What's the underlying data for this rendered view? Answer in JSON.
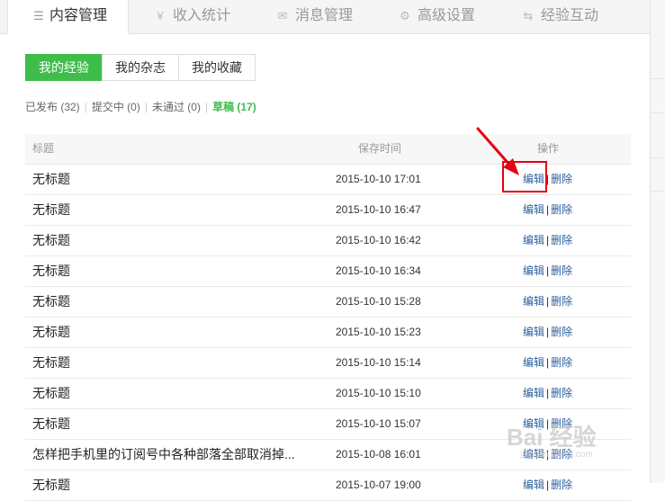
{
  "top_tabs": [
    {
      "label": "内容管理",
      "icon": "list-icon",
      "glyph": "☰",
      "active": true
    },
    {
      "label": "收入统计",
      "icon": "yen-icon",
      "glyph": "¥",
      "active": false
    },
    {
      "label": "消息管理",
      "icon": "envelope-icon",
      "glyph": "✉",
      "active": false
    },
    {
      "label": "高级设置",
      "icon": "gear-icon",
      "glyph": "⚙",
      "active": false
    },
    {
      "label": "经验互动",
      "icon": "exchange-icon",
      "glyph": "⇆",
      "active": false
    }
  ],
  "sub_tabs": [
    {
      "label": "我的经验",
      "active": true
    },
    {
      "label": "我的杂志",
      "active": false
    },
    {
      "label": "我的收藏",
      "active": false
    }
  ],
  "filters": [
    {
      "label": "已发布 (32)",
      "active": false
    },
    {
      "label": "提交中 (0)",
      "active": false
    },
    {
      "label": "未通过 (0)",
      "active": false
    },
    {
      "label": "草稿 (17)",
      "active": true
    }
  ],
  "filter_separator": "|",
  "table": {
    "headers": {
      "title": "标题",
      "time": "保存时间",
      "ops": "操作"
    },
    "edit_label": "编辑",
    "delete_label": "删除",
    "separator": "|",
    "rows": [
      {
        "title": "无标题",
        "time": "2015-10-10 17:01"
      },
      {
        "title": "无标题",
        "time": "2015-10-10 16:47"
      },
      {
        "title": "无标题",
        "time": "2015-10-10 16:42"
      },
      {
        "title": "无标题",
        "time": "2015-10-10 16:34"
      },
      {
        "title": "无标题",
        "time": "2015-10-10 15:28"
      },
      {
        "title": "无标题",
        "time": "2015-10-10 15:23"
      },
      {
        "title": "无标题",
        "time": "2015-10-10 15:14"
      },
      {
        "title": "无标题",
        "time": "2015-10-10 15:10"
      },
      {
        "title": "无标题",
        "time": "2015-10-10 15:07"
      },
      {
        "title": "怎样把手机里的订阅号中各种部落全部取消掉...",
        "time": "2015-10-08 16:01"
      },
      {
        "title": "无标题",
        "time": "2015-10-07 19:00"
      }
    ]
  },
  "watermark": {
    "text": "Bai 经验",
    "sub": "jingyan.baidu.com"
  },
  "colors": {
    "accent": "#3ebd4a",
    "link": "#2a5f9e",
    "annotation": "#e60012"
  }
}
